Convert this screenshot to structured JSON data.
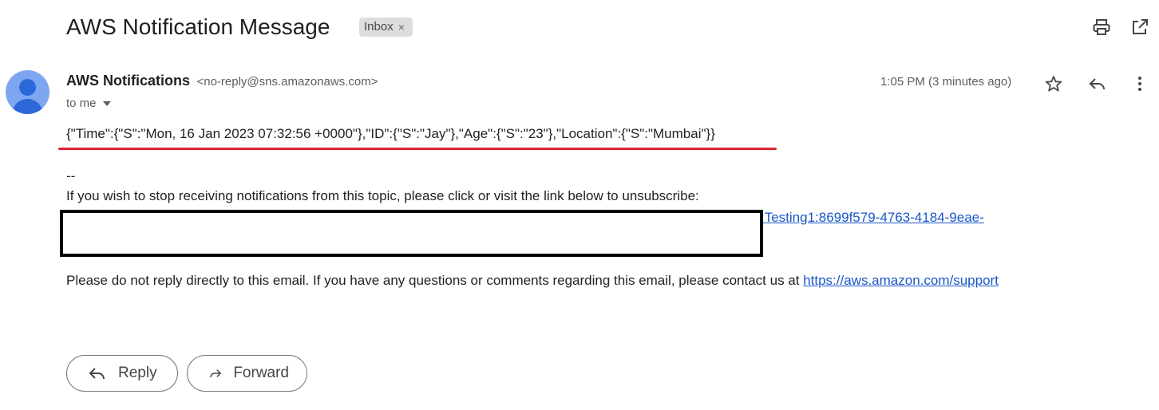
{
  "email": {
    "subject": "AWS Notification Message",
    "label": {
      "name": "Inbox",
      "remove_symbol": "×"
    },
    "sender": {
      "name": "AWS Notifications",
      "email": "<no-reply@sns.amazonaws.com>",
      "recipient": "to me",
      "time": "1:05 PM (3 minutes ago)"
    },
    "body": {
      "json_message": "{\"Time\":{\"S\":\"Mon, 16 Jan 2023 07:32:56 +0000\"},\"ID\":{\"S\":\"Jay\"},\"Age\":{\"S\":\"23\"},\"Location\":{\"S\":\"Mumbai\"}}",
      "signature_separator": "--",
      "unsubscribe_text": "If you wish to stop receiving notifications from this topic, please click or visit the link below to unsubscribe:",
      "unsubscribe_link_visible": ":Testing1:8699f579-4763-4184-9eae-",
      "contact_text": "Please do not reply directly to this email. If you have any questions or comments regarding this email, please contact us at ",
      "contact_link": "https://aws.amazon.com/support"
    },
    "buttons": {
      "reply": "Reply",
      "forward": "Forward"
    }
  },
  "icons": {
    "print": "print-icon",
    "open_new_window": "open-in-new-window-icon",
    "star": "star-icon",
    "reply": "reply-icon",
    "more": "more-vert-icon",
    "forward": "forward-icon"
  },
  "colors": {
    "link": "#1a57c8",
    "highlight_underline": "#e0242f",
    "avatar_bg": "#7ea6f0",
    "avatar_fg": "#2c68d8",
    "label_chip_bg": "#dddddd"
  }
}
